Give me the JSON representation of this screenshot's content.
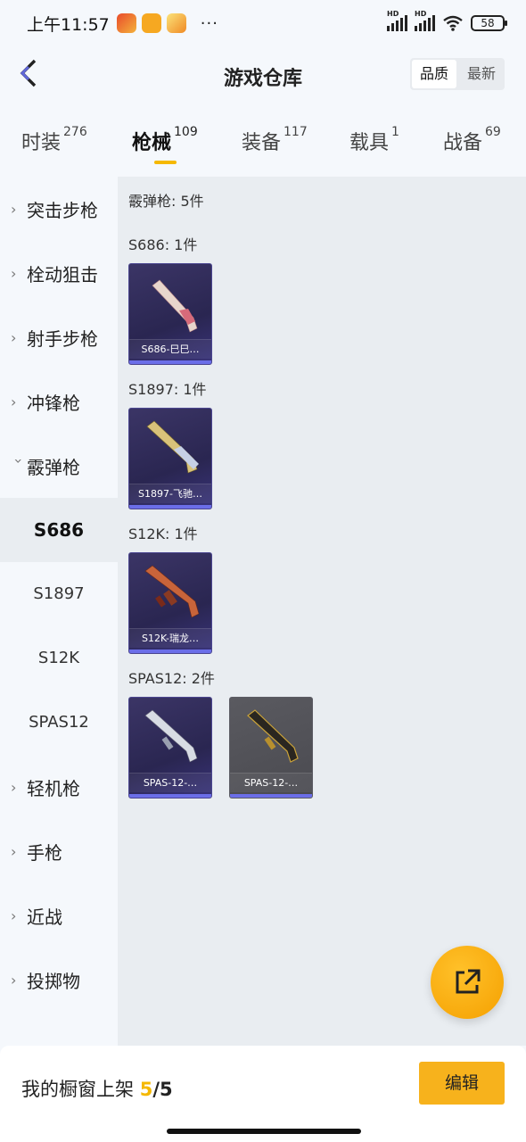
{
  "status": {
    "time": "上午11:57",
    "hd1": "HD",
    "hd2": "HD",
    "battery": "58",
    "dots": "···"
  },
  "header": {
    "title": "游戏仓库",
    "sort_quality": "品质",
    "sort_newest": "最新"
  },
  "tabs": [
    {
      "label": "时装",
      "count": "276"
    },
    {
      "label": "枪械",
      "count": "109"
    },
    {
      "label": "装备",
      "count": "117"
    },
    {
      "label": "载具",
      "count": "1"
    },
    {
      "label": "战备",
      "count": "69"
    }
  ],
  "sidebar": {
    "categories": [
      "突击步枪",
      "栓动狙击",
      "射手步枪",
      "冲锋枪",
      "霰弹枪",
      "轻机枪",
      "手枪",
      "近战",
      "投掷物"
    ],
    "subs": [
      "S686",
      "S1897",
      "S12K",
      "SPAS12"
    ]
  },
  "content": {
    "summary": "霰弹枪: 5件",
    "groups": [
      {
        "heading": "S686: 1件",
        "items": [
          "S686-巳巳…"
        ]
      },
      {
        "heading": "S1897: 1件",
        "items": [
          "S1897-飞驰…"
        ]
      },
      {
        "heading": "S12K: 1件",
        "items": [
          "S12K-瑞龙…"
        ]
      },
      {
        "heading": "SPAS12: 2件",
        "items": [
          "SPAS-12-…",
          "SPAS-12-…"
        ]
      }
    ]
  },
  "bottom": {
    "label": "我的橱窗上架",
    "count": "5",
    "total": "/5",
    "edit": "编辑"
  },
  "colors": {
    "accent": "#f5b800",
    "card_bg": "#2d2957",
    "card_bar": "#6b6ee8"
  }
}
